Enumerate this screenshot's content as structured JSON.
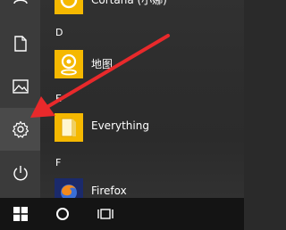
{
  "sidebar": {
    "buttons": [
      {
        "icon": "user-icon"
      },
      {
        "icon": "document-icon"
      },
      {
        "icon": "pictures-icon"
      },
      {
        "icon": "settings-gear-icon",
        "selected": true
      },
      {
        "icon": "power-icon"
      }
    ]
  },
  "app_list": {
    "items": [
      {
        "type": "app",
        "label": "Cortana (小娜)",
        "icon": "cortana-icon",
        "tile_color": "#f5b800"
      },
      {
        "type": "letter",
        "label": "D"
      },
      {
        "type": "app",
        "label": "地图",
        "icon": "maps-pin-icon",
        "tile_color": "#f5b800"
      },
      {
        "type": "letter",
        "label": "E"
      },
      {
        "type": "app",
        "label": "Everything",
        "icon": "everything-folder-icon",
        "tile_color": "#f5b800"
      },
      {
        "type": "letter",
        "label": "F"
      },
      {
        "type": "app",
        "label": "Firefox",
        "icon": "firefox-icon",
        "tile_color": "#1b2a6b"
      }
    ]
  },
  "taskbar": {
    "start_icon": "windows-logo-icon",
    "search_icon": "cortana-circle-icon",
    "task_view_icon": "task-view-icon"
  },
  "colors": {
    "accent_tile": "#f5b800",
    "annotation_arrow": "#e8292b"
  }
}
